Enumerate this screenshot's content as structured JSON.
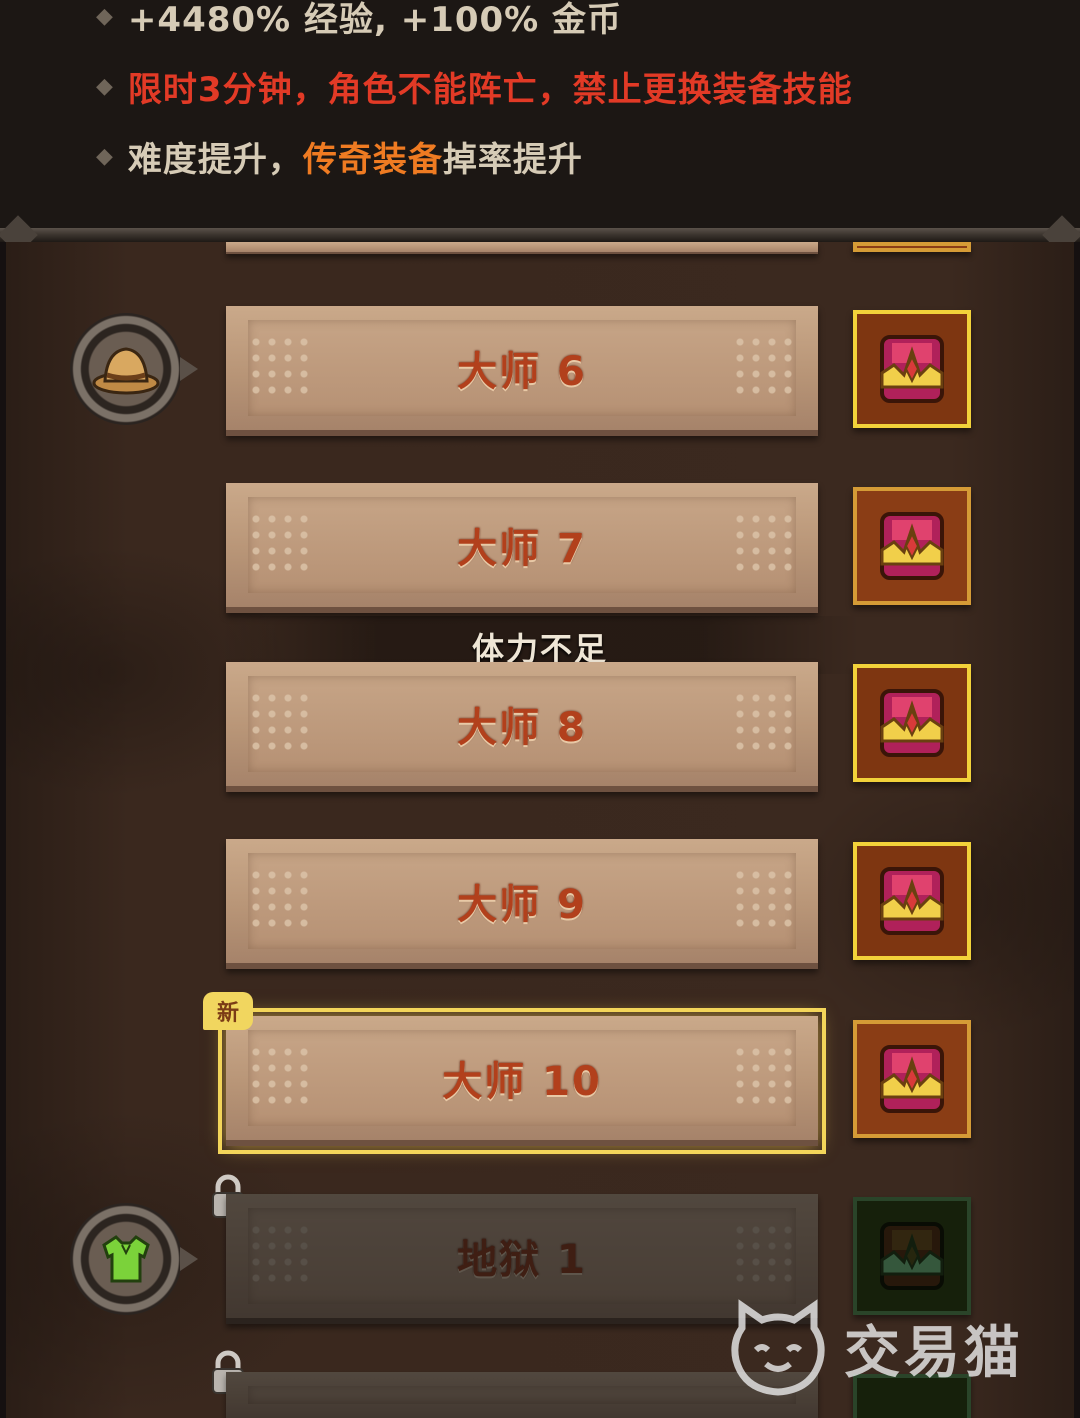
{
  "info": {
    "lines": [
      {
        "segments": [
          {
            "text": "+4480% 经验, +100% 金币",
            "style": "normal"
          }
        ]
      },
      {
        "segments": [
          {
            "text": "限时3分钟，角色不能阵亡，禁止更换装备技能",
            "style": "red"
          }
        ]
      },
      {
        "segments": [
          {
            "text": "难度提升，",
            "style": "normal"
          },
          {
            "text": "传奇装备",
            "style": "orange"
          },
          {
            "text": " 掉率提升",
            "style": "normal"
          }
        ]
      }
    ]
  },
  "levels": [
    {
      "label": "大师 6",
      "state": "available",
      "chest": "gold"
    },
    {
      "label": "大师 7",
      "state": "available",
      "chest": "normal"
    },
    {
      "label": "大师 8",
      "state": "available",
      "chest": "gold"
    },
    {
      "label": "大师 9",
      "state": "available",
      "chest": "gold"
    },
    {
      "label": "大师 10",
      "state": "new",
      "chest": "normal",
      "badge": "新"
    },
    {
      "label": "地狱 1",
      "state": "locked",
      "chest": "locked"
    }
  ],
  "toast": "体力不足",
  "watermark": "交易猫",
  "colors": {
    "red_text": "#e23a26",
    "orange_text": "#ef7b22",
    "level_label": "#b2401c",
    "highlight": "#f3d55a"
  },
  "icons": {
    "master_tier": "straw-hat-icon",
    "hell_tier": "green-armor-icon",
    "chest": "treasure-chest-icon",
    "lock": "lock-icon"
  }
}
